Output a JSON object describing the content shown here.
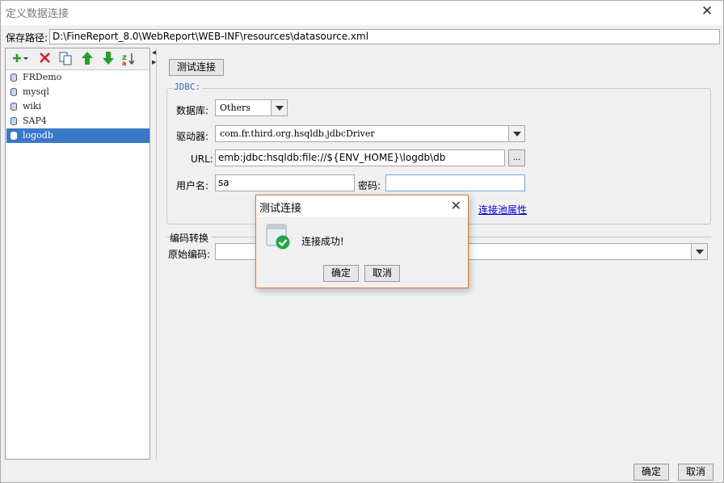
{
  "window": {
    "title": "定义数据连接",
    "close_glyph": "✕"
  },
  "save_path": {
    "label": "保存路径:",
    "value": "D:\\FineReport_8.0\\WebReport\\WEB-INF\\resources\\datasource.xml"
  },
  "toolbar": {
    "icons": [
      "add-icon",
      "delete-icon",
      "copy-icon",
      "move-up-icon",
      "move-down-icon",
      "sort-icon"
    ],
    "colors": {
      "add": "#2a9d2a",
      "delete": "#d42020",
      "arrows": "#2a9d2a"
    }
  },
  "connections": {
    "items": [
      {
        "label": "FRDemo"
      },
      {
        "label": "mysql"
      },
      {
        "label": "wiki"
      },
      {
        "label": "SAP4"
      },
      {
        "label": "logodb"
      }
    ],
    "selected_index": 4,
    "selected_color": "#3a78c8"
  },
  "test_button": "测试连接",
  "jdbc": {
    "legend": "JDBC:",
    "database_label": "数据库:",
    "database_value": "Others",
    "driver_label": "驱动器:",
    "driver_value": "com.fr.third.org.hsqldb.jdbcDriver",
    "url_label": "URL:",
    "url_value": "emb:jdbc:hsqldb:file://${ENV_HOME}\\logdb\\db",
    "url_browse": "...",
    "username_label": "用户名:",
    "username_value": "sa",
    "password_label": "密码:",
    "password_value": "",
    "pool_link": "连接池属性"
  },
  "encoding": {
    "header": "编码转换",
    "original_label": "原始编码:",
    "original_value": ""
  },
  "dialog": {
    "title": "测试连接",
    "close_glyph": "✕",
    "message": "连接成功!",
    "ok": "确定",
    "cancel": "取消"
  },
  "bottom": {
    "ok": "确定",
    "cancel": "取消"
  }
}
